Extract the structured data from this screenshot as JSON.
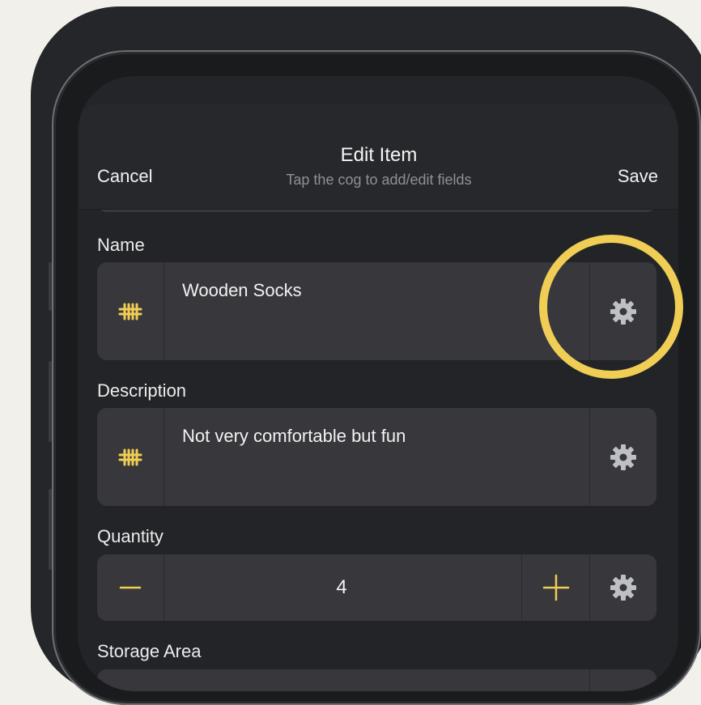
{
  "navbar": {
    "cancel_label": "Cancel",
    "title": "Edit Item",
    "subtitle": "Tap the cog to add/edit fields",
    "save_label": "Save"
  },
  "fields": {
    "name": {
      "label": "Name",
      "value": "Wooden Socks",
      "icon": "tally-icon",
      "settings_icon": "gear-icon"
    },
    "description": {
      "label": "Description",
      "value": "Not very comfortable but fun",
      "icon": "tally-icon",
      "settings_icon": "gear-icon"
    },
    "quantity": {
      "label": "Quantity",
      "value": "4",
      "decrement_icon": "minus-icon",
      "increment_icon": "plus-icon",
      "settings_icon": "gear-icon"
    },
    "storage_area": {
      "label": "Storage Area"
    }
  },
  "colors": {
    "accent": "#f0cd55",
    "background": "#222427",
    "field": "#38383c",
    "text": "#f2f2f2",
    "muted": "#8f9096",
    "gear": "#bfc0c4"
  }
}
